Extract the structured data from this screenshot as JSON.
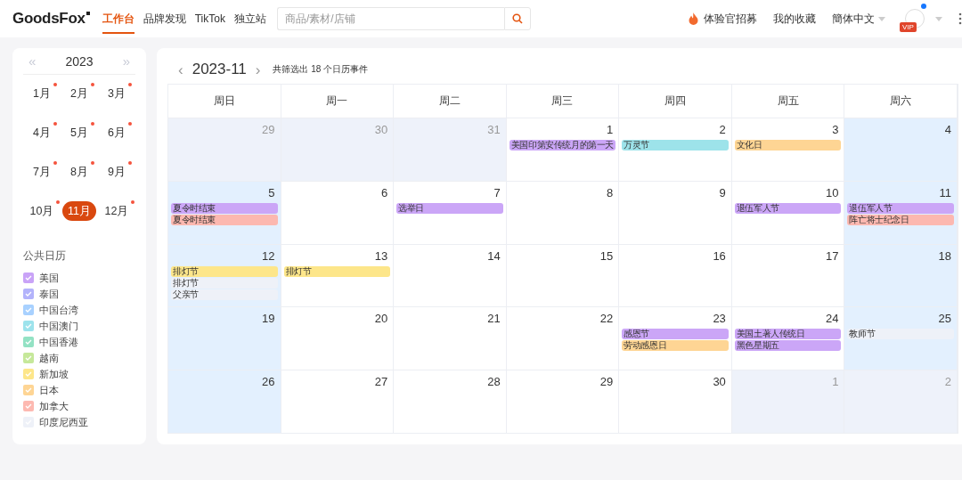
{
  "header": {
    "logo": "GoodsFox",
    "nav": [
      {
        "label": "工作台",
        "selected": true
      },
      {
        "label": "品牌发现",
        "selected": false
      },
      {
        "label": "TikTok",
        "selected": false
      },
      {
        "label": "独立站",
        "selected": false
      }
    ],
    "search": {
      "placeholder": "商品/素材/店铺"
    },
    "links": [
      "体验官招募",
      "我的收藏"
    ],
    "language": "簡体中文",
    "badge": "VIP"
  },
  "sidebar": {
    "year": "2023",
    "prev": "«",
    "next": "»",
    "months": [
      {
        "label": "1月",
        "selected": false,
        "has_events": true
      },
      {
        "label": "2月",
        "selected": false,
        "has_events": true
      },
      {
        "label": "3月",
        "selected": false,
        "has_events": true
      },
      {
        "label": "4月",
        "selected": false,
        "has_events": true
      },
      {
        "label": "5月",
        "selected": false,
        "has_events": true
      },
      {
        "label": "6月",
        "selected": false,
        "has_events": true
      },
      {
        "label": "7月",
        "selected": false,
        "has_events": true
      },
      {
        "label": "8月",
        "selected": false,
        "has_events": true
      },
      {
        "label": "9月",
        "selected": false,
        "has_events": true
      },
      {
        "label": "10月",
        "selected": false,
        "has_events": true
      },
      {
        "label": "11月",
        "selected": true,
        "has_events": false
      },
      {
        "label": "12月",
        "selected": false,
        "has_events": true
      }
    ],
    "calendars_title": "公共日历",
    "calendars": [
      {
        "label": "美国",
        "checked": true,
        "color": "#c9a3f7"
      },
      {
        "label": "泰国",
        "checked": true,
        "color": "#b3b3fb"
      },
      {
        "label": "中国台湾",
        "checked": true,
        "color": "#a8d1ff"
      },
      {
        "label": "中国澳门",
        "checked": true,
        "color": "#9de3ec"
      },
      {
        "label": "中国香港",
        "checked": true,
        "color": "#93e2c4"
      },
      {
        "label": "越南",
        "checked": true,
        "color": "#c6e89a"
      },
      {
        "label": "新加坡",
        "checked": true,
        "color": "#fde68a"
      },
      {
        "label": "日本",
        "checked": true,
        "color": "#fed594"
      },
      {
        "label": "加拿大",
        "checked": true,
        "color": "#fdb9b1"
      },
      {
        "label": "印度尼西亚",
        "checked": true,
        "color": "#eef1f8"
      }
    ]
  },
  "calendar": {
    "prev": "‹",
    "title": "2023-11",
    "next": "›",
    "summary": "共筛选出 18 个日历事件",
    "weekdays": [
      "周日",
      "周一",
      "周二",
      "周三",
      "周四",
      "周五",
      "周六"
    ],
    "weeks": [
      [
        {
          "day": "29",
          "kind": "other"
        },
        {
          "day": "30",
          "kind": "other"
        },
        {
          "day": "31",
          "kind": "other"
        },
        {
          "day": "1",
          "kind": "day",
          "events": [
            {
              "label": "美国印第安传统月的第一天",
              "color": "#cba6f7"
            }
          ]
        },
        {
          "day": "2",
          "kind": "day",
          "events": [
            {
              "label": "万灵节",
              "color": "#9de3ea"
            }
          ]
        },
        {
          "day": "3",
          "kind": "day",
          "events": [
            {
              "label": "文化日",
              "color": "#fed594"
            }
          ]
        },
        {
          "day": "4",
          "kind": "weekend"
        }
      ],
      [
        {
          "day": "5",
          "kind": "weekend",
          "events": [
            {
              "label": "夏令时结束",
              "color": "#cba6f7"
            },
            {
              "label": "夏令时结束",
              "color": "#fcb8b0"
            }
          ]
        },
        {
          "day": "6",
          "kind": "day"
        },
        {
          "day": "7",
          "kind": "day",
          "events": [
            {
              "label": "选举日",
              "color": "#cba6f7"
            }
          ]
        },
        {
          "day": "8",
          "kind": "day"
        },
        {
          "day": "9",
          "kind": "day"
        },
        {
          "day": "10",
          "kind": "day",
          "events": [
            {
              "label": "退伍军人节",
              "color": "#cba6f7"
            }
          ]
        },
        {
          "day": "11",
          "kind": "weekend",
          "events": [
            {
              "label": "退伍军人节",
              "color": "#cba6f7"
            },
            {
              "label": "阵亡将士纪念日",
              "color": "#fcb8b0"
            }
          ]
        }
      ],
      [
        {
          "day": "12",
          "kind": "weekend",
          "events": [
            {
              "label": "排灯节",
              "color": "#fde68a"
            },
            {
              "label": "排灯节",
              "color": "#eef1f8"
            },
            {
              "label": "父亲节",
              "color": "#eef1f8"
            }
          ]
        },
        {
          "day": "13",
          "kind": "day",
          "events": [
            {
              "label": "排灯节",
              "color": "#fde68a"
            }
          ]
        },
        {
          "day": "14",
          "kind": "day"
        },
        {
          "day": "15",
          "kind": "day"
        },
        {
          "day": "16",
          "kind": "day"
        },
        {
          "day": "17",
          "kind": "day"
        },
        {
          "day": "18",
          "kind": "weekend"
        }
      ],
      [
        {
          "day": "19",
          "kind": "weekend"
        },
        {
          "day": "20",
          "kind": "day"
        },
        {
          "day": "21",
          "kind": "day"
        },
        {
          "day": "22",
          "kind": "day"
        },
        {
          "day": "23",
          "kind": "day",
          "events": [
            {
              "label": "感恩节",
              "color": "#cba6f7"
            },
            {
              "label": "劳动感恩日",
              "color": "#fed594"
            }
          ]
        },
        {
          "day": "24",
          "kind": "day",
          "events": [
            {
              "label": "美国土著人传统日",
              "color": "#cba6f7"
            },
            {
              "label": "黑色星期五",
              "color": "#cba6f7"
            }
          ]
        },
        {
          "day": "25",
          "kind": "weekend",
          "events": [
            {
              "label": "教师节",
              "color": "#eef1f8"
            }
          ]
        }
      ],
      [
        {
          "day": "26",
          "kind": "weekend"
        },
        {
          "day": "27",
          "kind": "day"
        },
        {
          "day": "28",
          "kind": "day"
        },
        {
          "day": "29",
          "kind": "day"
        },
        {
          "day": "30",
          "kind": "day"
        },
        {
          "day": "1",
          "kind": "other"
        },
        {
          "day": "2",
          "kind": "other"
        }
      ]
    ]
  }
}
